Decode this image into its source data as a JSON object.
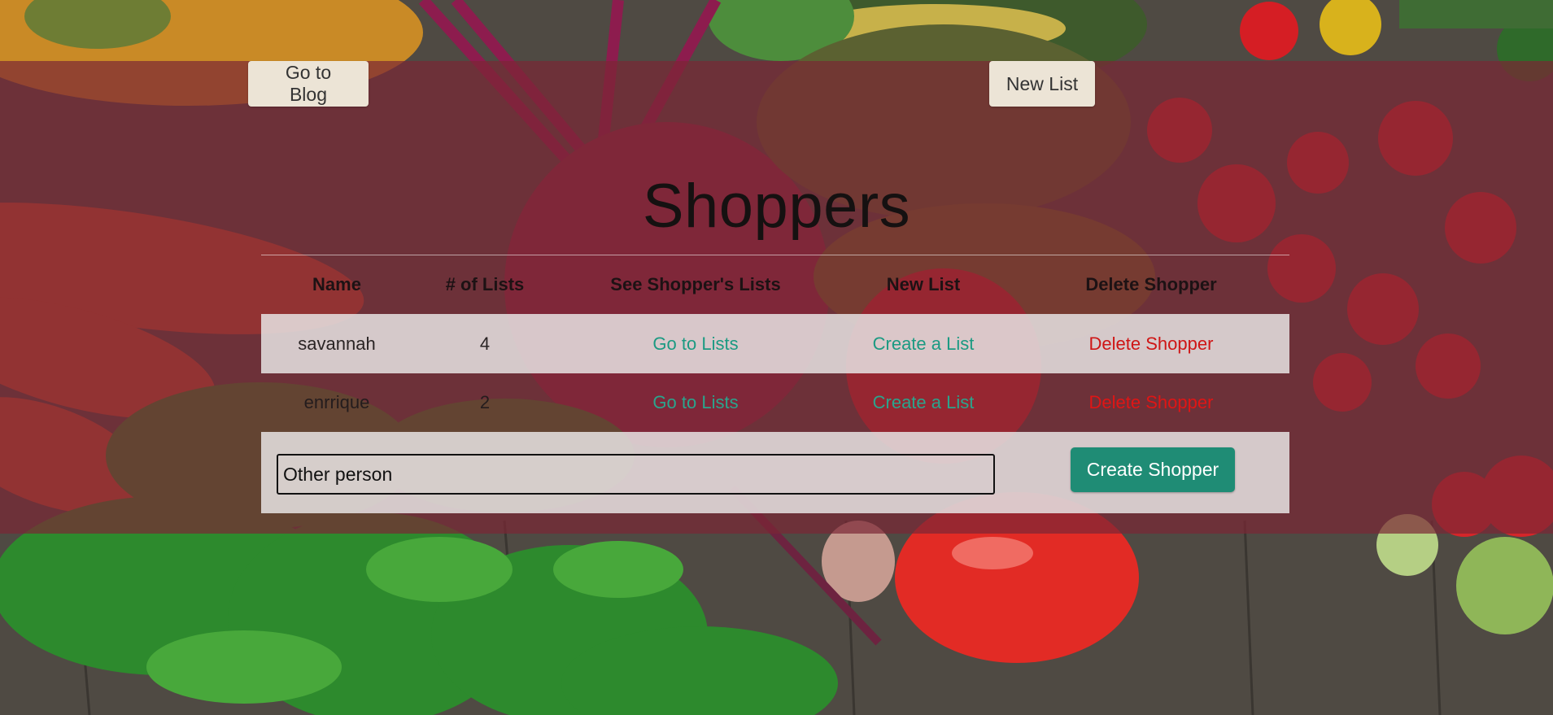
{
  "nav": {
    "blog_button": "Go to Blog",
    "new_list_button": "New List"
  },
  "page": {
    "title": "Shoppers"
  },
  "table": {
    "headers": [
      "Name",
      "# of Lists",
      "See Shopper's Lists",
      "New List",
      "Delete Shopper"
    ],
    "rows": [
      {
        "name": "savannah",
        "lists": "4",
        "go_link": "Go to Lists",
        "create_link": "Create a List",
        "delete_link": "Delete Shopper"
      },
      {
        "name": "enrrique",
        "lists": "2",
        "go_link": "Go to Lists",
        "create_link": "Create a List",
        "delete_link": "Delete Shopper"
      }
    ]
  },
  "form": {
    "input_value": "Other person",
    "submit_label": "Create Shopper"
  },
  "colors": {
    "overlay": "#7a2634",
    "link": "#1b9a82",
    "delete": "#cf1515",
    "primary_button": "#1f8c75",
    "nav_button": "#ece4d6"
  }
}
